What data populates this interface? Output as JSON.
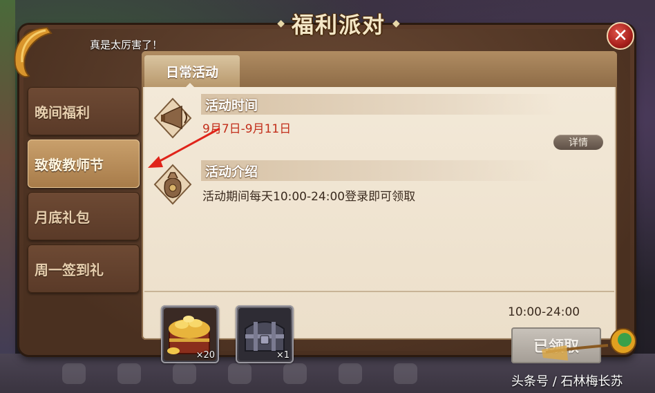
{
  "title": "福利派对",
  "marquee": "真是太厉害了！",
  "sidebar": {
    "items": [
      {
        "label": "晚间福利",
        "active": false
      },
      {
        "label": "致敬教师节",
        "active": true
      },
      {
        "label": "月底礼包",
        "active": false
      },
      {
        "label": "周一签到礼",
        "active": false
      }
    ]
  },
  "panel": {
    "tab_label": "日常活动",
    "time_section": {
      "header": "活动时间",
      "date_range": "9月7日-9月11日",
      "detail_button": "详情"
    },
    "intro_section": {
      "header": "活动介绍",
      "description": "活动期间每天10:00-24:00登录即可领取"
    },
    "rewards": [
      {
        "icon": "gold-treasure-chest-icon",
        "count": "×20"
      },
      {
        "icon": "iron-chest-icon",
        "count": "×1"
      }
    ],
    "claim_time": "10:00-24:00",
    "claim_button": "已领取"
  },
  "watermark": "头条号 / 石林梅长苏",
  "colors": {
    "accent_red": "#c22e1a",
    "frame_brown": "#5a3a28",
    "panel_bg": "#f3e9d8",
    "active_tab_gold": "#c9a06c",
    "annotation_arrow": "#e0241a"
  }
}
